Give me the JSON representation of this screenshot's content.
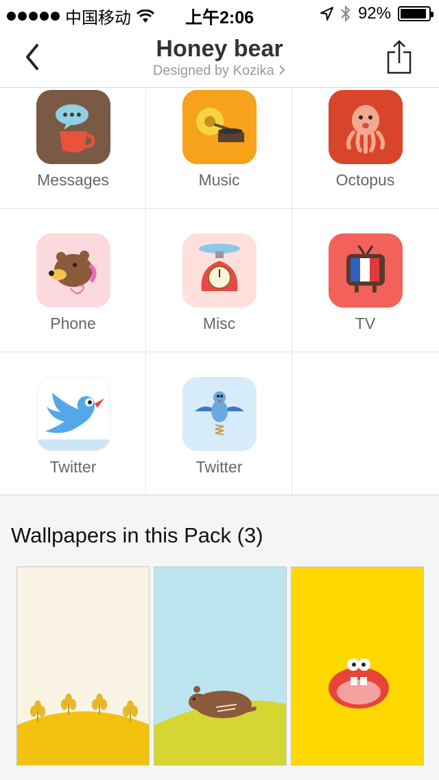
{
  "status_bar": {
    "carrier": "中国移动",
    "time": "上午2:06",
    "battery_percent": "92%",
    "battery_level": 0.92,
    "signal_dots": 5
  },
  "nav": {
    "title": "Honey bear",
    "subtitle": "Designed by Kozika",
    "back_icon": "chevron-left-icon",
    "share_icon": "share-icon"
  },
  "icons": [
    {
      "label": "Messages",
      "icon": "coffee-cup-speech-icon",
      "bg": "#7a5a44"
    },
    {
      "label": "Music",
      "icon": "gramophone-icon",
      "bg": "#f6a21a"
    },
    {
      "label": "Octopus",
      "icon": "octopus-icon",
      "bg": "#d9452a"
    },
    {
      "label": "Phone",
      "icon": "bear-phone-icon",
      "bg": "#fbd9dd"
    },
    {
      "label": "Misc",
      "icon": "kitchen-scale-icon",
      "bg": "#fde0dc"
    },
    {
      "label": "TV",
      "icon": "tv-icon",
      "bg": "#f2625a"
    },
    {
      "label": "Twitter",
      "icon": "blue-bird-icon",
      "bg": "#ffffff"
    },
    {
      "label": "Twitter",
      "icon": "bird-spring-icon",
      "bg": "#d6ecfa"
    }
  ],
  "wallpapers": {
    "title": "Wallpapers in this Pack (3)",
    "items": [
      {
        "name": "flowers-hill",
        "bg": "#f9f4e3"
      },
      {
        "name": "bear-on-hill",
        "bg": "#bde5ef"
      },
      {
        "name": "yellow-mouth",
        "bg": "#ffd800"
      }
    ]
  }
}
